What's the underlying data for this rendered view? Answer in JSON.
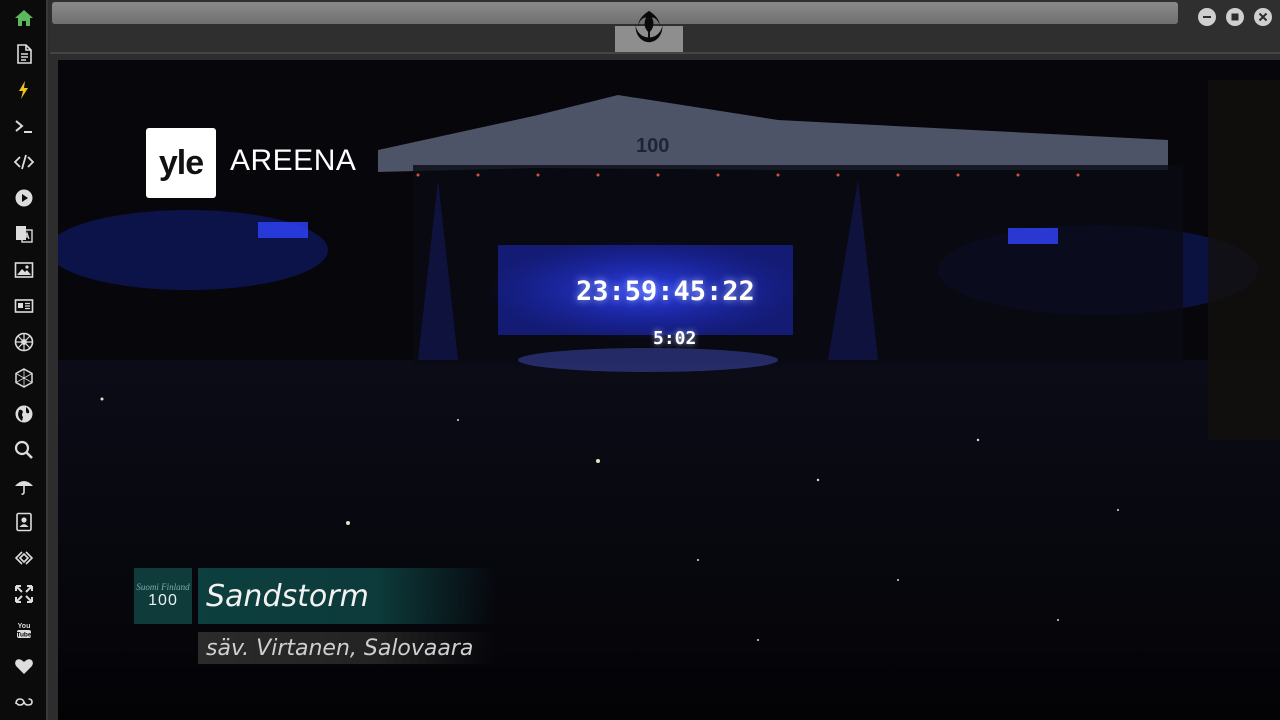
{
  "sidebar": {
    "items": [
      {
        "icon": "home-icon",
        "color": "#5cb85c"
      },
      {
        "icon": "document-icon"
      },
      {
        "icon": "lightning-icon",
        "color": "#f0c419"
      },
      {
        "icon": "terminal-icon"
      },
      {
        "icon": "code-icon"
      },
      {
        "icon": "play-icon"
      },
      {
        "icon": "translate-icon"
      },
      {
        "icon": "image-icon"
      },
      {
        "icon": "news-icon"
      },
      {
        "icon": "galactic-empire-icon"
      },
      {
        "icon": "hexagon-icon"
      },
      {
        "icon": "globe-icon"
      },
      {
        "icon": "search-icon"
      },
      {
        "icon": "umbrella-icon"
      },
      {
        "icon": "contacts-icon"
      },
      {
        "icon": "api-icon"
      },
      {
        "icon": "expand-icon"
      },
      {
        "icon": "youtube-icon",
        "text": "You Tube"
      },
      {
        "icon": "heart-icon"
      },
      {
        "icon": "infinity-cloud-icon"
      }
    ]
  },
  "titlebar": {
    "logo_icon": "rebel-alliance-icon",
    "window_buttons": [
      "minimize-icon",
      "maximize-icon",
      "close-icon"
    ]
  },
  "video": {
    "brand": "yle",
    "brand_service": "AREENA",
    "stage_banner": "Suomi Finland 100",
    "countdown": "23:59:45:22",
    "countdown_sub": "5:02",
    "lower_third": {
      "badge_text": "Suomi Finland",
      "badge_number": "100",
      "title": "Sandstorm",
      "subtitle": "säv. Virtanen, Salovaara"
    }
  },
  "colors": {
    "sidebar_bg": "#0b0b0b",
    "accent_green": "#5cb85c",
    "accent_yellow": "#f0c419",
    "stage_blue": "#2a3dff",
    "lower_third_teal": "#0d3f3f"
  }
}
